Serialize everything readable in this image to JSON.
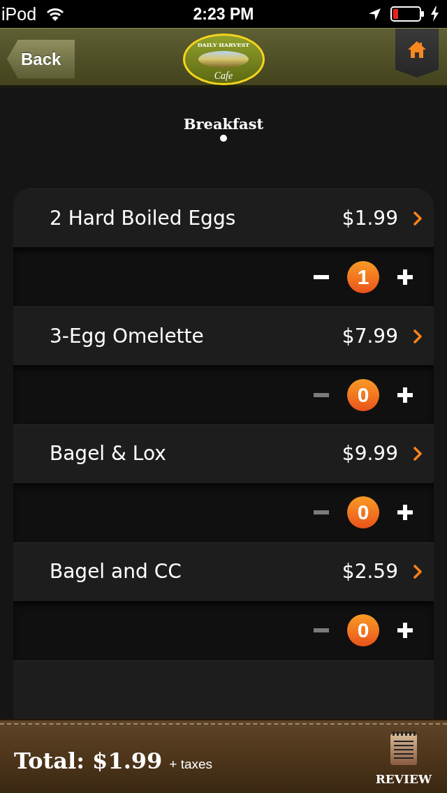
{
  "status_bar": {
    "carrier": "iPod",
    "time": "2:23 PM"
  },
  "nav": {
    "back": "Back",
    "logo": {
      "top": "DAILY HARVEST",
      "bottom": "Cafe"
    }
  },
  "category": {
    "title": "Breakfast",
    "page_dots": [
      {
        "selected": true
      }
    ]
  },
  "items": [
    {
      "name": "2 Hard Boiled Eggs",
      "price": "$1.99",
      "quantity": "1",
      "decrease_disabled": false
    },
    {
      "name": "3-Egg Omelette",
      "price": "$7.99",
      "quantity": "0",
      "decrease_disabled": true
    },
    {
      "name": "Bagel & Lox",
      "price": "$9.99",
      "quantity": "0",
      "decrease_disabled": true
    },
    {
      "name": "Bagel and CC",
      "price": "$2.59",
      "quantity": "0",
      "decrease_disabled": true
    }
  ],
  "footer": {
    "total": "Total: $1.99",
    "note": "+ taxes",
    "review": "REVIEW"
  }
}
